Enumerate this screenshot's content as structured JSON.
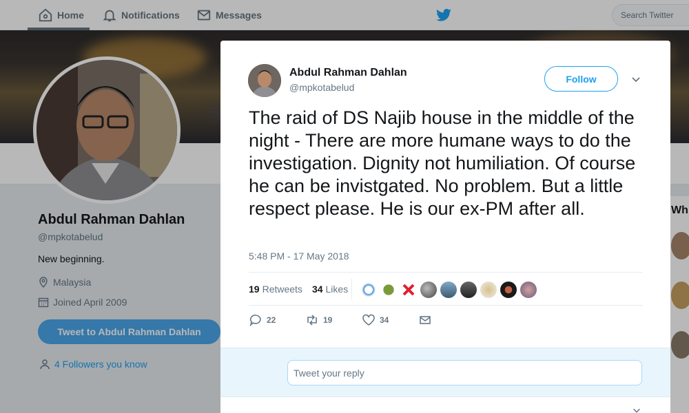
{
  "nav": {
    "home": "Home",
    "notifications": "Notifications",
    "messages": "Messages",
    "search_placeholder": "Search Twitter"
  },
  "profile": {
    "name": "Abdul Rahman Dahlan",
    "handle": "@mpkotabelud",
    "bio": "New beginning.",
    "location": "Malaysia",
    "joined": "Joined April 2009",
    "tweet_to_button": "Tweet to Abdul Rahman Dahlan",
    "followers_you_know": "4 Followers you know"
  },
  "right_column": {
    "heading_fragment": "Wh"
  },
  "tweet": {
    "author_name": "Abdul Rahman Dahlan",
    "author_handle": "@mpkotabelud",
    "follow_button": "Follow",
    "text": "The raid of DS Najib house in the middle of the night - There are more humane ways to do the investigation. Dignity not humiliation. Of course he can be invistgated. No problem. But a little respect please. He is our ex-PM after all.",
    "timestamp": "5:48 PM - 17 May 2018",
    "retweets_count": "19",
    "retweets_label": "Retweets",
    "likes_count": "34",
    "likes_label": "Likes",
    "action_reply_count": "22",
    "action_retweet_count": "19",
    "action_like_count": "34",
    "reply_placeholder": "Tweet your reply"
  },
  "colors": {
    "accent": "#1da1f2",
    "tweet_to_button": "#4aa7ea",
    "page_bg": "#e6ecf0",
    "retweet_hover": "#17bf63"
  },
  "icons": [
    "home-icon",
    "bell-icon",
    "envelope-icon",
    "twitter-bird-icon",
    "location-pin-icon",
    "calendar-icon",
    "people-icon",
    "chevron-down-icon",
    "reply-icon",
    "retweet-icon",
    "heart-icon",
    "dm-icon"
  ]
}
